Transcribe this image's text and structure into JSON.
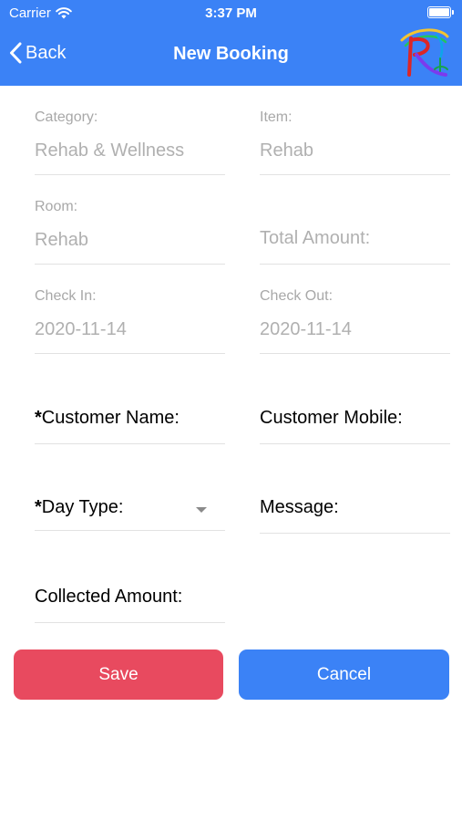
{
  "status_bar": {
    "carrier": "Carrier",
    "time": "3:37 PM"
  },
  "nav": {
    "back_label": "Back",
    "title": "New Booking",
    "logo_letter": "R"
  },
  "form": {
    "category": {
      "label": "Category:",
      "value": "Rehab & Wellness"
    },
    "item": {
      "label": "Item:",
      "value": "Rehab"
    },
    "room": {
      "label": "Room:",
      "value": "Rehab"
    },
    "total_amount": {
      "label": "Total Amount:"
    },
    "check_in": {
      "label": "Check In:",
      "value": "2020-11-14"
    },
    "check_out": {
      "label": "Check Out:",
      "value": "2020-11-14"
    },
    "customer_name": {
      "required_mark": "*",
      "label": "Customer Name:"
    },
    "customer_mobile": {
      "label": "Customer Mobile:"
    },
    "day_type": {
      "required_mark": "*",
      "label": "Day Type:"
    },
    "message": {
      "label": "Message:"
    },
    "collected_amount": {
      "label": "Collected Amount:"
    }
  },
  "buttons": {
    "save": "Save",
    "cancel": "Cancel"
  },
  "colors": {
    "header": "#3b82f6",
    "save": "#e84a5f",
    "cancel": "#3b82f6"
  }
}
